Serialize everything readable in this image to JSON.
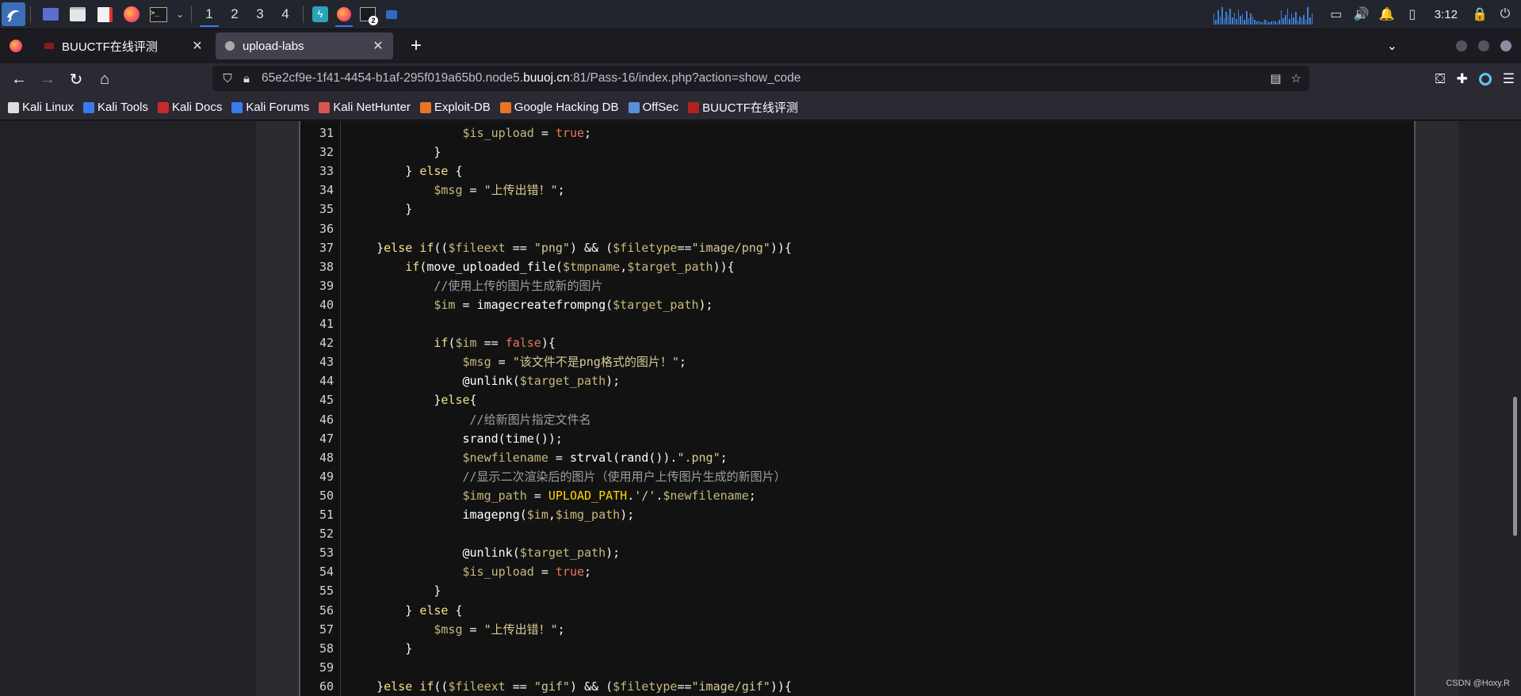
{
  "panel": {
    "workspaces": [
      "1",
      "2",
      "3",
      "4"
    ],
    "active_workspace": "1",
    "terminal_badge": "2",
    "clock": "3:12"
  },
  "tabs": [
    {
      "label": "BUUCTF在线评测",
      "selected": false,
      "icon": "buuctf-icon"
    },
    {
      "label": "upload-labs",
      "selected": true,
      "icon": "upload-labs-icon"
    }
  ],
  "url": {
    "prefix": "65e2cf9e-1f41-4454-b1af-295f019a65b0.node5.",
    "domain": "buuoj.cn",
    "suffix": ":81/Pass-16/index.php?action=show_code"
  },
  "bookmarks": [
    {
      "label": "Kali Linux",
      "color": "#dddddd"
    },
    {
      "label": "Kali Tools",
      "color": "#367bf0"
    },
    {
      "label": "Kali Docs",
      "color": "#c72a2a"
    },
    {
      "label": "Kali Forums",
      "color": "#367bf0"
    },
    {
      "label": "Kali NetHunter",
      "color": "#d9534f"
    },
    {
      "label": "Exploit-DB",
      "color": "#e8742a"
    },
    {
      "label": "Google Hacking DB",
      "color": "#e8742a"
    },
    {
      "label": "OffSec",
      "color": "#5b8fd9"
    },
    {
      "label": "BUUCTF在线评测",
      "color": "#b22222"
    }
  ],
  "code": [
    {
      "n": "31",
      "tokens": [
        [
          "                ",
          ""
        ],
        [
          "$is_upload",
          "var"
        ],
        [
          " = ",
          ""
        ],
        [
          "true",
          "bool"
        ],
        [
          ";",
          ""
        ]
      ]
    },
    {
      "n": "32",
      "tokens": [
        [
          "            }",
          ""
        ]
      ]
    },
    {
      "n": "33",
      "tokens": [
        [
          "        } ",
          ""
        ],
        [
          "else",
          "kw"
        ],
        [
          " {",
          ""
        ]
      ]
    },
    {
      "n": "34",
      "tokens": [
        [
          "            ",
          ""
        ],
        [
          "$msg",
          "var"
        ],
        [
          " = ",
          ""
        ],
        [
          "\"上传出错！\"",
          "str"
        ],
        [
          ";",
          ""
        ]
      ]
    },
    {
      "n": "35",
      "tokens": [
        [
          "        }",
          ""
        ]
      ]
    },
    {
      "n": "36",
      "tokens": [
        [
          "",
          ""
        ]
      ]
    },
    {
      "n": "37",
      "tokens": [
        [
          "    }",
          ""
        ],
        [
          "else if",
          "kw"
        ],
        [
          "((",
          ""
        ],
        [
          "$fileext",
          "var"
        ],
        [
          " == ",
          ""
        ],
        [
          "\"png\"",
          "str"
        ],
        [
          ") && (",
          ""
        ],
        [
          "$filetype",
          "var"
        ],
        [
          "==",
          ""
        ],
        [
          "\"image/png\"",
          "str"
        ],
        [
          "))",
          ""
        ],
        [
          "{",
          ""
        ]
      ]
    },
    {
      "n": "38",
      "tokens": [
        [
          "        ",
          ""
        ],
        [
          "if",
          "kw"
        ],
        [
          "(",
          ""
        ],
        [
          "move_uploaded_file",
          "fn"
        ],
        [
          "(",
          ""
        ],
        [
          "$tmpname",
          "var"
        ],
        [
          ",",
          ""
        ],
        [
          "$target_path",
          "var"
        ],
        [
          "))",
          ""
        ],
        [
          "{",
          ""
        ]
      ]
    },
    {
      "n": "39",
      "tokens": [
        [
          "            ",
          ""
        ],
        [
          "//使用上传的图片生成新的图片",
          "cm"
        ]
      ]
    },
    {
      "n": "40",
      "tokens": [
        [
          "            ",
          ""
        ],
        [
          "$im",
          "var"
        ],
        [
          " = ",
          ""
        ],
        [
          "imagecreatefrompng",
          "fn"
        ],
        [
          "(",
          ""
        ],
        [
          "$target_path",
          "var"
        ],
        [
          ");",
          ""
        ]
      ]
    },
    {
      "n": "41",
      "tokens": [
        [
          "",
          ""
        ]
      ]
    },
    {
      "n": "42",
      "tokens": [
        [
          "            ",
          ""
        ],
        [
          "if",
          "kw"
        ],
        [
          "(",
          ""
        ],
        [
          "$im",
          "var"
        ],
        [
          " == ",
          ""
        ],
        [
          "false",
          "bool"
        ],
        [
          ")",
          ""
        ],
        [
          "{",
          ""
        ]
      ]
    },
    {
      "n": "43",
      "tokens": [
        [
          "                ",
          ""
        ],
        [
          "$msg",
          "var"
        ],
        [
          " = ",
          ""
        ],
        [
          "\"该文件不是png格式的图片！\"",
          "str"
        ],
        [
          ";",
          ""
        ]
      ]
    },
    {
      "n": "44",
      "tokens": [
        [
          "                ",
          ""
        ],
        [
          "@unlink",
          "fn"
        ],
        [
          "(",
          ""
        ],
        [
          "$target_path",
          "var"
        ],
        [
          ");",
          ""
        ]
      ]
    },
    {
      "n": "45",
      "tokens": [
        [
          "            }",
          ""
        ],
        [
          "else",
          "kw"
        ],
        [
          "{",
          ""
        ]
      ]
    },
    {
      "n": "46",
      "tokens": [
        [
          "                 ",
          ""
        ],
        [
          "//给新图片指定文件名",
          "cm"
        ]
      ]
    },
    {
      "n": "47",
      "tokens": [
        [
          "                ",
          ""
        ],
        [
          "srand",
          "fn"
        ],
        [
          "(",
          ""
        ],
        [
          "time",
          "fn"
        ],
        [
          "());",
          ""
        ]
      ]
    },
    {
      "n": "48",
      "tokens": [
        [
          "                ",
          ""
        ],
        [
          "$newfilename",
          "var"
        ],
        [
          " = ",
          ""
        ],
        [
          "strval",
          "fn"
        ],
        [
          "(",
          ""
        ],
        [
          "rand",
          "fn"
        ],
        [
          "()).",
          ""
        ],
        [
          "\".png\"",
          "str"
        ],
        [
          ";",
          ""
        ]
      ]
    },
    {
      "n": "49",
      "tokens": [
        [
          "                ",
          ""
        ],
        [
          "//显示二次渲染后的图片（使用用户上传图片生成的新图片）",
          "cm"
        ]
      ]
    },
    {
      "n": "50",
      "tokens": [
        [
          "                ",
          ""
        ],
        [
          "$img_path",
          "var"
        ],
        [
          " = ",
          ""
        ],
        [
          "UPLOAD_PATH",
          "const"
        ],
        [
          ".",
          ""
        ],
        [
          "'/'",
          "str"
        ],
        [
          ".",
          ""
        ],
        [
          "$newfilename",
          "var"
        ],
        [
          ";",
          ""
        ]
      ]
    },
    {
      "n": "51",
      "tokens": [
        [
          "                ",
          ""
        ],
        [
          "imagepng",
          "fn"
        ],
        [
          "(",
          ""
        ],
        [
          "$im",
          "var"
        ],
        [
          ",",
          ""
        ],
        [
          "$img_path",
          "var"
        ],
        [
          ");",
          ""
        ]
      ]
    },
    {
      "n": "52",
      "tokens": [
        [
          "",
          ""
        ]
      ]
    },
    {
      "n": "53",
      "tokens": [
        [
          "                ",
          ""
        ],
        [
          "@unlink",
          "fn"
        ],
        [
          "(",
          ""
        ],
        [
          "$target_path",
          "var"
        ],
        [
          ");",
          ""
        ]
      ]
    },
    {
      "n": "54",
      "tokens": [
        [
          "                ",
          ""
        ],
        [
          "$is_upload",
          "var"
        ],
        [
          " = ",
          ""
        ],
        [
          "true",
          "bool"
        ],
        [
          ";",
          ""
        ]
      ]
    },
    {
      "n": "55",
      "tokens": [
        [
          "            }",
          ""
        ]
      ]
    },
    {
      "n": "56",
      "tokens": [
        [
          "        } ",
          ""
        ],
        [
          "else",
          "kw"
        ],
        [
          " {",
          ""
        ]
      ]
    },
    {
      "n": "57",
      "tokens": [
        [
          "            ",
          ""
        ],
        [
          "$msg",
          "var"
        ],
        [
          " = ",
          ""
        ],
        [
          "\"上传出错！\"",
          "str"
        ],
        [
          ";",
          ""
        ]
      ]
    },
    {
      "n": "58",
      "tokens": [
        [
          "        }",
          ""
        ]
      ]
    },
    {
      "n": "59",
      "tokens": [
        [
          "",
          ""
        ]
      ]
    },
    {
      "n": "60",
      "tokens": [
        [
          "    }",
          ""
        ],
        [
          "else if",
          "kw"
        ],
        [
          "((",
          ""
        ],
        [
          "$fileext",
          "var"
        ],
        [
          " == ",
          ""
        ],
        [
          "\"gif\"",
          "str"
        ],
        [
          ") && (",
          ""
        ],
        [
          "$filetype",
          "var"
        ],
        [
          "==",
          ""
        ],
        [
          "\"image/gif\"",
          "str"
        ],
        [
          "))",
          ""
        ],
        [
          "{",
          ""
        ]
      ]
    }
  ],
  "watermark": "CSDN @Hoxy.R"
}
